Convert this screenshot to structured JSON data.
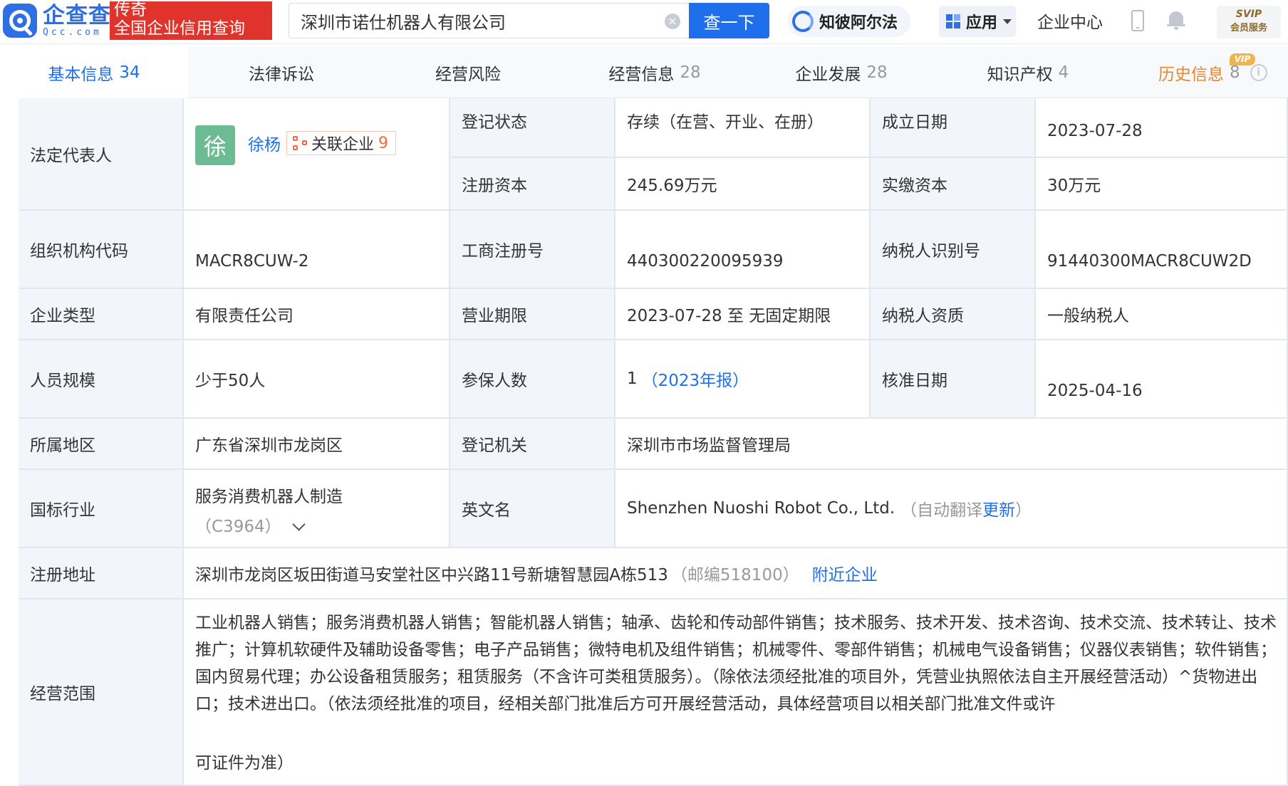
{
  "header": {
    "logo_cn": "企查查",
    "logo_en": "Qcc.com",
    "slogan_line1": "传奇",
    "slogan_line2": "全国企业信用查询",
    "search_value": "深圳市诺仕机器人有限公司",
    "search_button": "查一下",
    "zhibi_label": "知彼阿尔法",
    "apps_label": "应用",
    "enterprise_center": "企业中心",
    "svip_line1": "SVIP",
    "svip_line2": "会员服务",
    "accent_color": "#1f6fed",
    "slogan_color": "#e0332c"
  },
  "tabs": [
    {
      "label": "基本信息",
      "count": "34"
    },
    {
      "label": "法律诉讼",
      "count": ""
    },
    {
      "label": "经营风险",
      "count": ""
    },
    {
      "label": "经营信息",
      "count": "28"
    },
    {
      "label": "企业发展",
      "count": "28"
    },
    {
      "label": "知识产权",
      "count": "4"
    },
    {
      "label": "历史信息",
      "count": "8",
      "badge": "VIP"
    }
  ],
  "info": {
    "legal_rep_label": "法定代表人",
    "legal_rep_avatar": "徐",
    "legal_rep_name": "徐杨",
    "related_label": "关联企业",
    "related_count": "9",
    "reg_status_label": "登记状态",
    "reg_status": "存续（在营、开业、在册）",
    "found_date_label": "成立日期",
    "found_date": "2023-07-28",
    "reg_capital_label": "注册资本",
    "reg_capital": "245.69万元",
    "paid_capital_label": "实缴资本",
    "paid_capital": "30万元",
    "org_code_label": "组织机构代码",
    "org_code": "MACR8CUW-2",
    "biz_reg_no_label": "工商注册号",
    "biz_reg_no": "440300220095939",
    "tax_id_label": "纳税人识别号",
    "tax_id": "91440300MACR8CUW2D",
    "company_type_label": "企业类型",
    "company_type": "有限责任公司",
    "biz_term_label": "营业期限",
    "biz_term": "2023-07-28 至 无固定期限",
    "taxpayer_qual_label": "纳税人资质",
    "taxpayer_qual": "一般纳税人",
    "staff_size_label": "人员规模",
    "staff_size": "少于50人",
    "insured_label": "参保人数",
    "insured_count": "1",
    "insured_year": "（2023年报）",
    "approve_date_label": "核准日期",
    "approve_date": "2025-04-16",
    "region_label": "所属地区",
    "region": "广东省深圳市龙岗区",
    "reg_authority_label": "登记机关",
    "reg_authority": "深圳市市场监督管理局",
    "industry_label": "国标行业",
    "industry": "服务消费机器人制造",
    "industry_code": "（C3964）",
    "en_name_label": "英文名",
    "en_name": "Shenzhen Nuoshi Robot Co., Ltd.",
    "en_name_note_prefix": "（自动翻译",
    "en_name_update": "更新",
    "en_name_note_suffix": "）",
    "address_label": "注册地址",
    "address": "深圳市龙岗区坂田街道马安堂社区中兴路11号新塘智慧园A栋513",
    "postcode": "（邮编518100）",
    "nearby_link": "附近企业",
    "scope_label": "经营范围",
    "scope_text": "工业机器人销售；服务消费机器人销售；智能机器人销售；轴承、齿轮和传动部件销售；技术服务、技术开发、技术咨询、技术交流、技术转让、技术推广；计算机软硬件及辅助设备零售；电子产品销售；微特电机及组件销售；机械零件、零部件销售；机械电气设备销售；仪器仪表销售；软件销售；国内贸易代理；办公设备租赁服务；租赁服务（不含许可类租赁服务）。（除依法须经批准的项目外，凭营业执照依法自主开展经营活动）^货物进出口；技术进出口。（依法须经批准的项目，经相关部门批准后方可开展经营活动，具体经营项目以相关部门批准文件或许",
    "scope_tail": "可证件为准）"
  }
}
